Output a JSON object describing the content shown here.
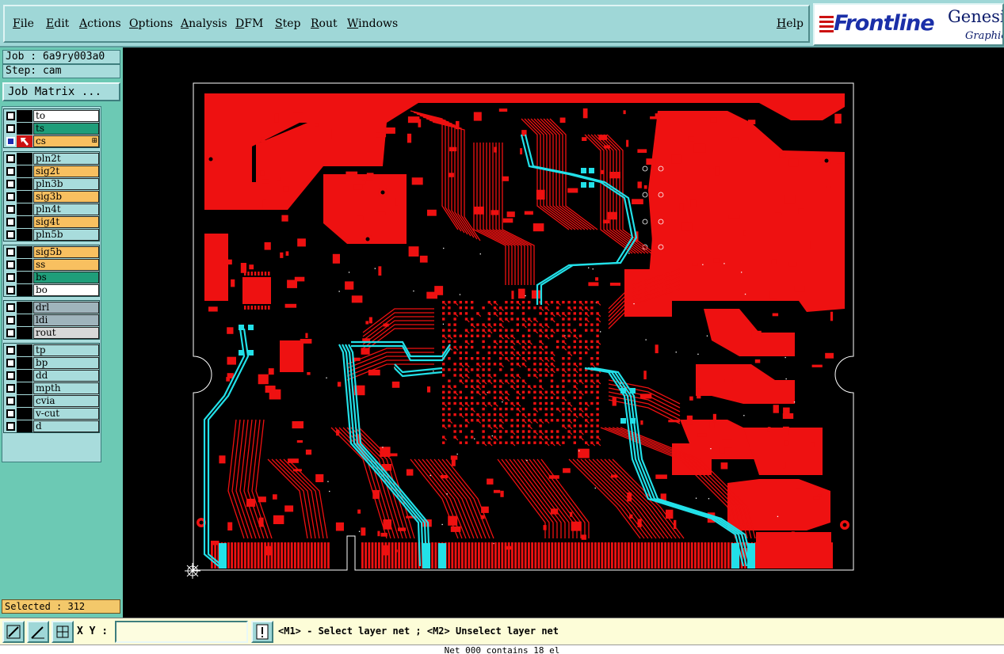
{
  "menu": {
    "items": [
      "File",
      "Edit",
      "Actions",
      "Options",
      "Analysis",
      "DFM",
      "Step",
      "Rout",
      "Windows"
    ],
    "help": "Help"
  },
  "logo": {
    "brand": "Frontline",
    "title": "Genesi",
    "subtitle": "Graphic"
  },
  "job": {
    "job_label": "Job : 6a9ry003a0",
    "step_label": "Step: cam",
    "matrix_button": "Job Matrix ..."
  },
  "layers": [
    {
      "name": "to",
      "color": "#ffffff",
      "on": false
    },
    {
      "name": "ts",
      "color": "#1f9e7a",
      "on": false
    },
    {
      "name": "cs",
      "color": "#f8c060",
      "on": true,
      "active": true
    },
    {
      "name": "pln2t",
      "color": "#a8dcdc",
      "on": false
    },
    {
      "name": "sig2t",
      "color": "#f8c060",
      "on": false
    },
    {
      "name": "pln3b",
      "color": "#a8dcdc",
      "on": false
    },
    {
      "name": "sig3b",
      "color": "#f8c060",
      "on": false
    },
    {
      "name": "pln4t",
      "color": "#a8dcdc",
      "on": false
    },
    {
      "name": "sig4t",
      "color": "#f8c060",
      "on": false
    },
    {
      "name": "pln5b",
      "color": "#a8dcdc",
      "on": false
    },
    {
      "name": "sig5b",
      "color": "#f8c060",
      "on": false
    },
    {
      "name": "ss",
      "color": "#f8c060",
      "on": false
    },
    {
      "name": "bs",
      "color": "#1f9e7a",
      "on": false
    },
    {
      "name": "bo",
      "color": "#ffffff",
      "on": false
    },
    {
      "name": "drl",
      "color": "#9fb4bc",
      "on": false
    },
    {
      "name": "ldi",
      "color": "#9fb4bc",
      "on": false
    },
    {
      "name": "rout",
      "color": "#d8d8d8",
      "on": false
    },
    {
      "name": "tp",
      "color": "#a8dcdc",
      "on": false
    },
    {
      "name": "bp",
      "color": "#a8dcdc",
      "on": false
    },
    {
      "name": "dd",
      "color": "#a8dcdc",
      "on": false
    },
    {
      "name": "mpth",
      "color": "#a8dcdc",
      "on": false
    },
    {
      "name": "cvia",
      "color": "#a8dcdc",
      "on": false
    },
    {
      "name": "v-cut",
      "color": "#a8dcdc",
      "on": false
    },
    {
      "name": "d",
      "color": "#a8dcdc",
      "on": false
    }
  ],
  "selected": "Selected : 312",
  "toolbar": {
    "xy_label": "X Y :",
    "xy_value": "",
    "hint": "<M1> - Select layer net ; <M2> Unselect layer net"
  },
  "status": "Net 000 contains 18 el",
  "colors": {
    "copper": "#ee1111",
    "selected_net": "#22e0e8",
    "background": "#000000",
    "outline": "#ffffff",
    "panel": "#6cc9b4",
    "menubar": "#9fd7d7"
  }
}
